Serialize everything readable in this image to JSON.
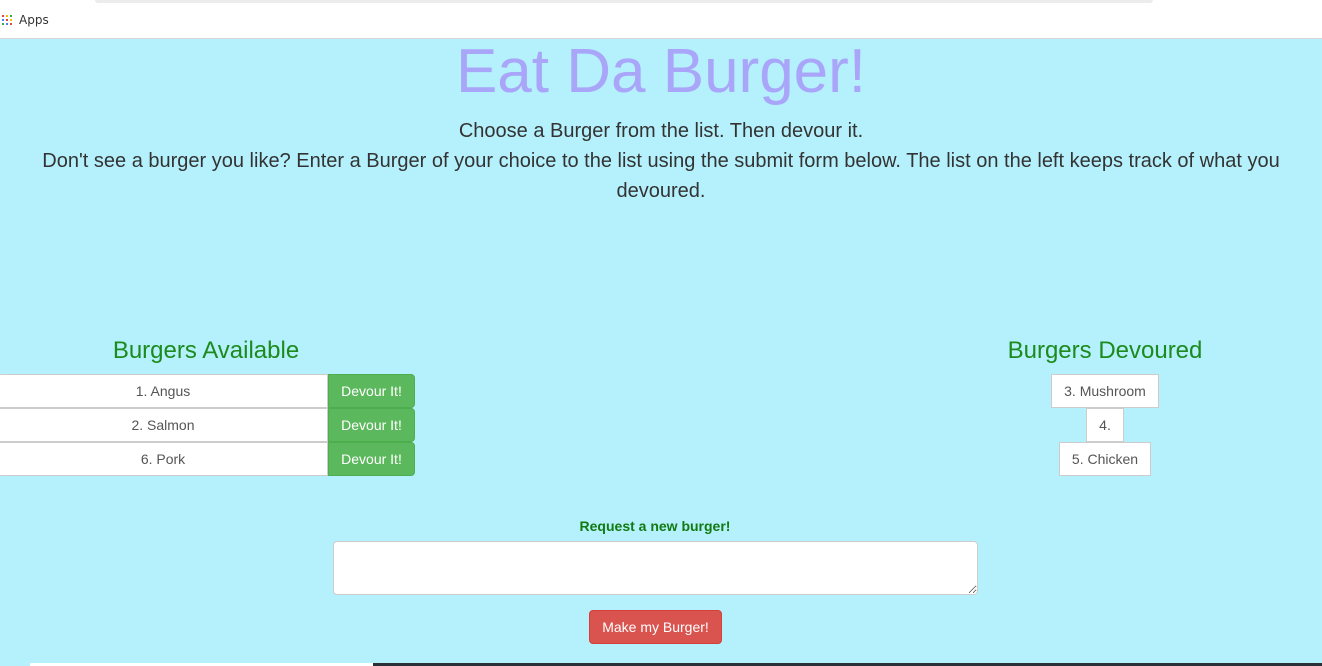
{
  "browser": {
    "bookmarks": {
      "apps_label": "Apps",
      "apps_icon": "apps-grid-icon",
      "apps_icon_colors": [
        "#ea4335",
        "#fbbc05",
        "#34a853",
        "#4285f4",
        "#ea4335",
        "#fbbc05",
        "#34a853",
        "#4285f4",
        "#ea4335"
      ]
    }
  },
  "page": {
    "title": "Eat Da Burger!",
    "intro_line1": "Choose a Burger from the list. Then devour it.",
    "intro_line2": "Don't see a burger you like? Enter a Burger of your choice to the list using the submit form below. The list on the left keeps track of what you devoured.",
    "background_color": "#b5f1fc",
    "title_color": "#a9a6fa"
  },
  "available": {
    "heading": "Burgers Available",
    "button_label": "Devour It!",
    "items": [
      {
        "name": "1. Angus"
      },
      {
        "name": "2. Salmon"
      },
      {
        "name": "6. Pork"
      }
    ]
  },
  "devoured": {
    "heading": "Burgers Devoured",
    "items": [
      {
        "name": "3. Mushroom"
      },
      {
        "name": "4."
      },
      {
        "name": "5. Chicken"
      }
    ]
  },
  "form": {
    "label": "Request a new burger!",
    "input_value": "",
    "submit_label": "Make my Burger!"
  },
  "colors": {
    "heading_green": "#1c8a1c",
    "devour_button": "#5cb85c",
    "submit_button": "#d9534f"
  }
}
